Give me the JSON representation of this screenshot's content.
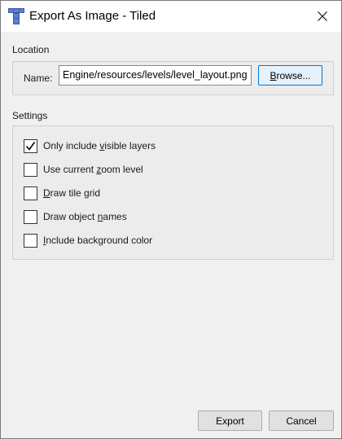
{
  "window": {
    "title": "Export As Image - Tiled",
    "app_icon": "tiled-icon",
    "close_icon": "close-icon"
  },
  "location": {
    "group_title": "Location",
    "name_label": "Name:",
    "name_value": "Engine/resources/levels/level_layout.png",
    "browse_label_pre": "",
    "browse_label_accel": "B",
    "browse_label_post": "rowse..."
  },
  "settings": {
    "group_title": "Settings",
    "options": [
      {
        "pre": "Only include ",
        "accel": "v",
        "post": "isible layers",
        "checked": true
      },
      {
        "pre": "Use current ",
        "accel": "z",
        "post": "oom level",
        "checked": false
      },
      {
        "pre": "",
        "accel": "D",
        "post": "raw tile grid",
        "checked": false
      },
      {
        "pre": "Draw object ",
        "accel": "n",
        "post": "ames",
        "checked": false
      },
      {
        "pre": "",
        "accel": "I",
        "post": "nclude background color",
        "checked": false
      }
    ]
  },
  "footer": {
    "export_label": "Export",
    "cancel_label": "Cancel"
  }
}
